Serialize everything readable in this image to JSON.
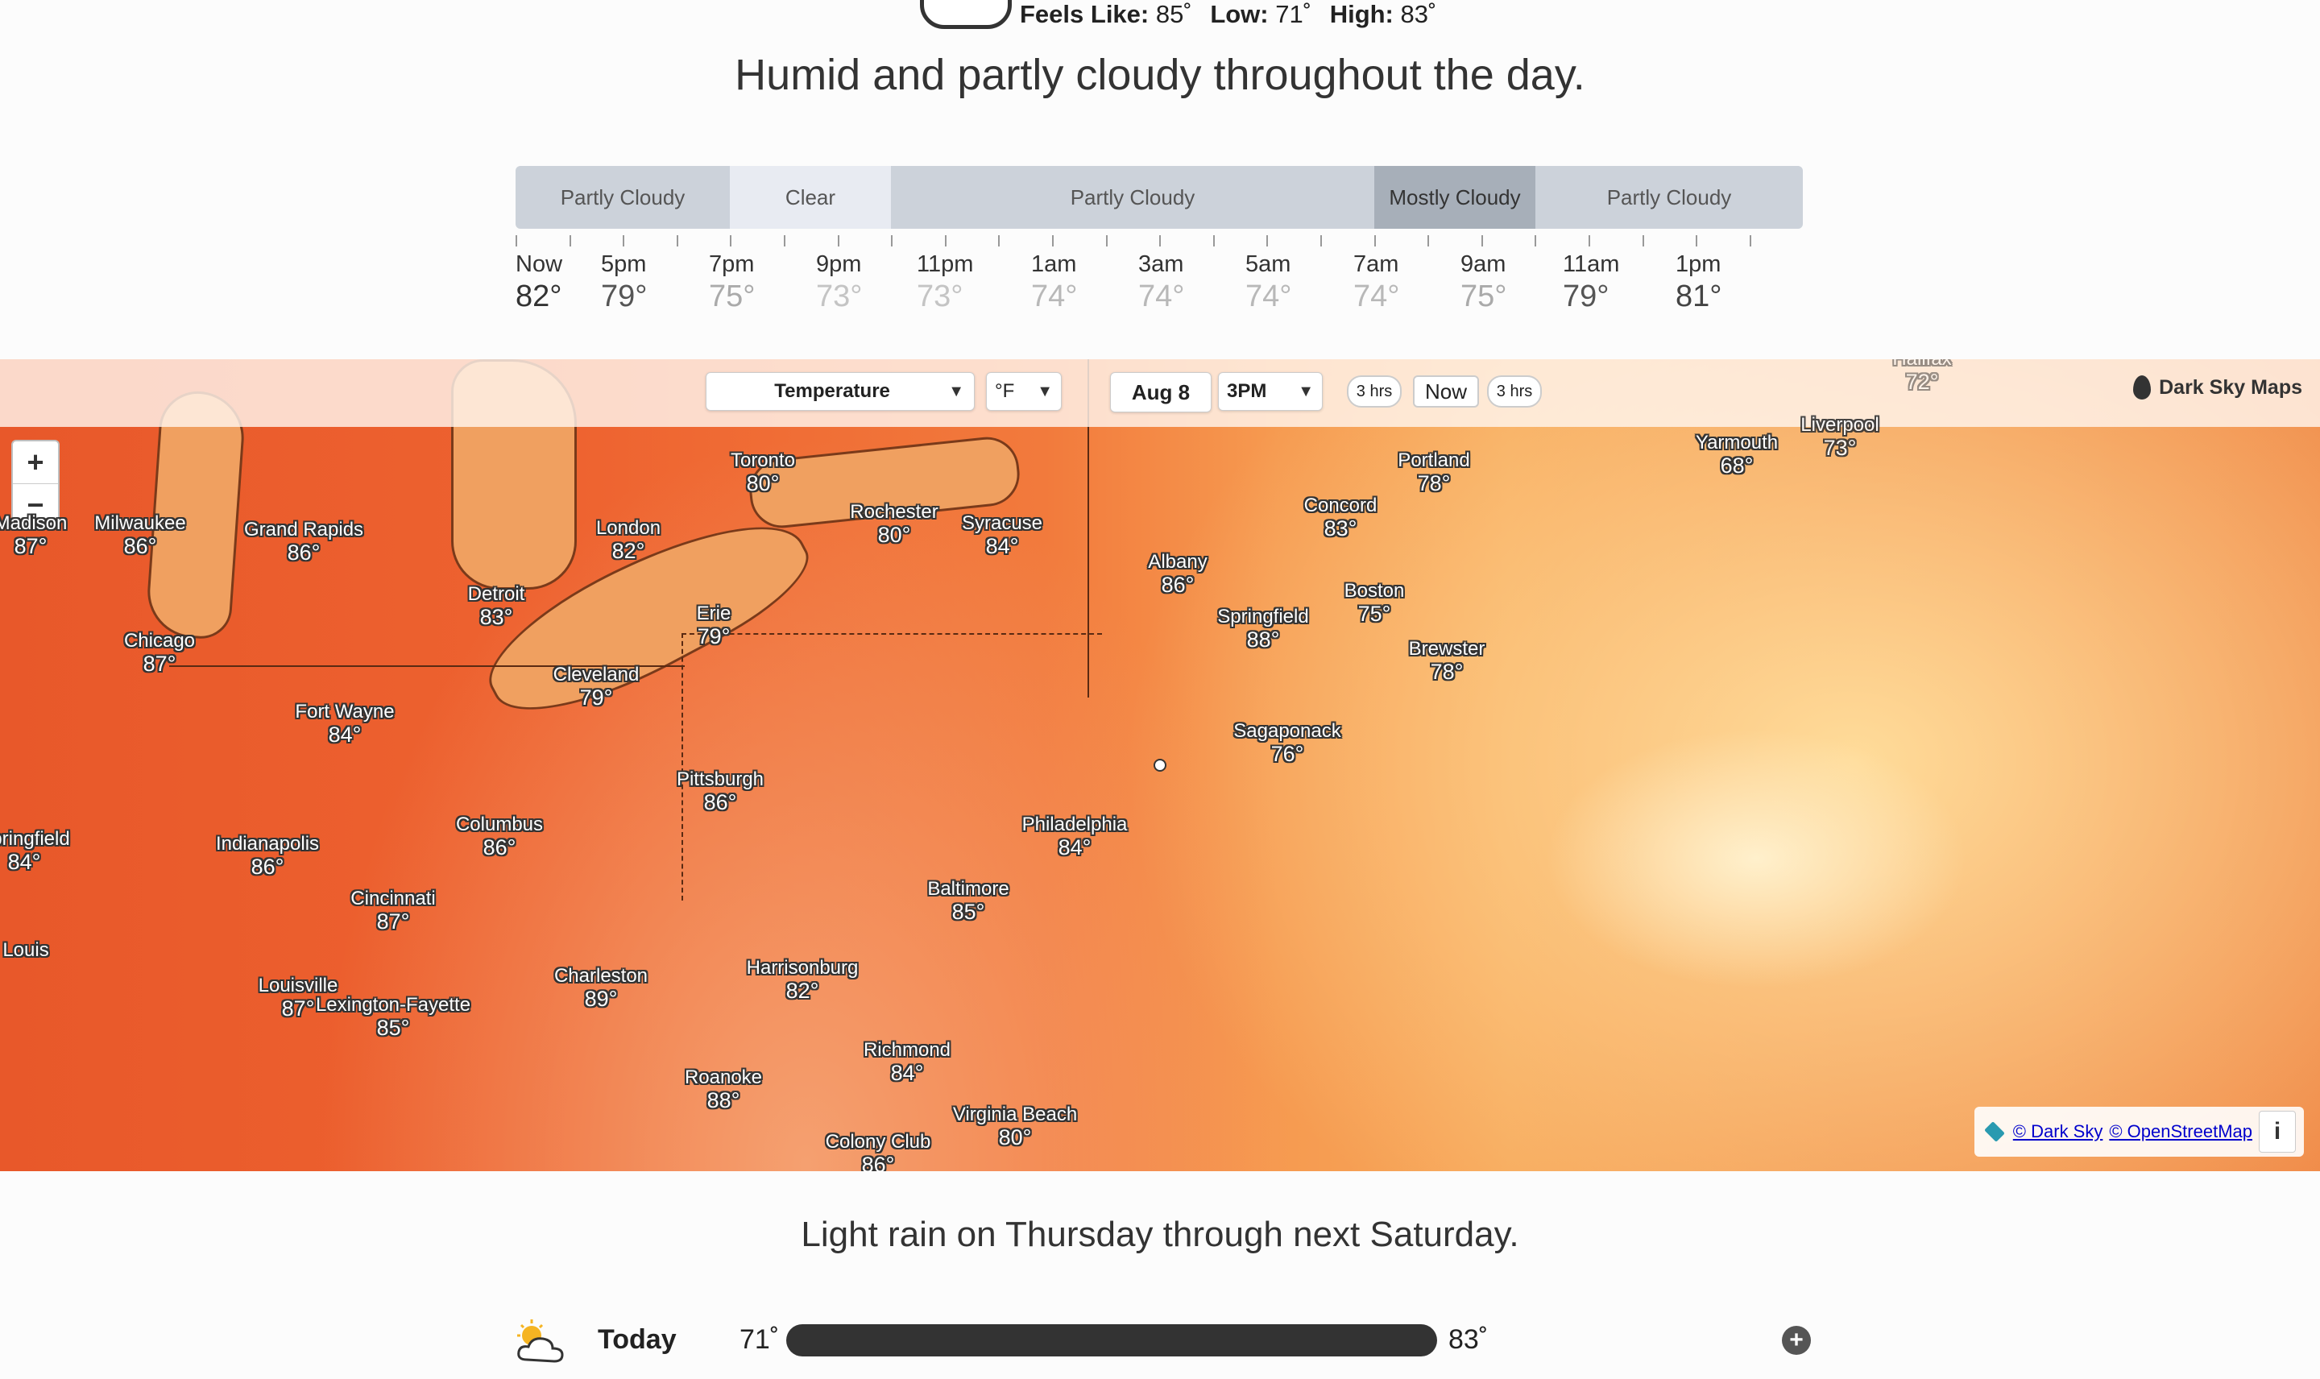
{
  "current": {
    "feels_label": "Feels Like:",
    "feels_value": "85˚",
    "low_label": "Low:",
    "low_value": "71˚",
    "high_label": "High:",
    "high_value": "83˚",
    "summary": "Humid and partly cloudy throughout the day."
  },
  "timeline": {
    "segments": [
      {
        "label": "Partly Cloudy",
        "type": "partly-cloudy"
      },
      {
        "label": "Clear",
        "type": "clear"
      },
      {
        "label": "Partly Cloudy",
        "type": "partly-cloudy"
      },
      {
        "label": "Mostly Cloudy",
        "type": "mostly-cloudy"
      },
      {
        "label": "Partly Cloudy",
        "type": "partly-cloudy"
      }
    ],
    "hours": [
      {
        "label": "Now",
        "temp": "82°"
      },
      {
        "label": "5pm",
        "temp": "79°"
      },
      {
        "label": "7pm",
        "temp": "75°"
      },
      {
        "label": "9pm",
        "temp": "73°"
      },
      {
        "label": "11pm",
        "temp": "73°"
      },
      {
        "label": "1am",
        "temp": "74°"
      },
      {
        "label": "3am",
        "temp": "74°"
      },
      {
        "label": "5am",
        "temp": "74°"
      },
      {
        "label": "7am",
        "temp": "74°"
      },
      {
        "label": "9am",
        "temp": "75°"
      },
      {
        "label": "11am",
        "temp": "79°"
      },
      {
        "label": "1pm",
        "temp": "81°"
      }
    ]
  },
  "map": {
    "layer_select": "Temperature",
    "unit_select": "°F",
    "date": "Aug 8",
    "time_select": "3PM",
    "step_back": "3 hrs",
    "now_label": "Now",
    "step_forward": "3 hrs",
    "brand": "Dark Sky Maps",
    "zoom_in": "+",
    "zoom_out": "−",
    "attribution_darksky": "© Dark Sky",
    "attribution_osm": "© OpenStreetMap",
    "info": "i",
    "cities": [
      {
        "name": "Toronto",
        "temp": "80°"
      },
      {
        "name": "Rochester",
        "temp": "80°"
      },
      {
        "name": "Syracuse",
        "temp": "84°"
      },
      {
        "name": "Portland",
        "temp": "78°"
      },
      {
        "name": "Concord",
        "temp": "83°"
      },
      {
        "name": "Yarmouth",
        "temp": "68°"
      },
      {
        "name": "Liverpool",
        "temp": "73°"
      },
      {
        "name": "Halifax",
        "temp": "72°"
      },
      {
        "name": "Madison",
        "temp": "87°"
      },
      {
        "name": "Milwaukee",
        "temp": "86°"
      },
      {
        "name": "Grand Rapids",
        "temp": "86°"
      },
      {
        "name": "London",
        "temp": "82°"
      },
      {
        "name": "Albany",
        "temp": "86°"
      },
      {
        "name": "Detroit",
        "temp": "83°"
      },
      {
        "name": "Boston",
        "temp": "75°"
      },
      {
        "name": "Springfield",
        "temp": "88°"
      },
      {
        "name": "Erie",
        "temp": "79°"
      },
      {
        "name": "Chicago",
        "temp": "87°"
      },
      {
        "name": "Brewster",
        "temp": "78°"
      },
      {
        "name": "Cleveland",
        "temp": "79°"
      },
      {
        "name": "Fort Wayne",
        "temp": "84°"
      },
      {
        "name": "Sagaponack",
        "temp": "76°"
      },
      {
        "name": "Pittsburgh",
        "temp": "86°"
      },
      {
        "name": "Columbus",
        "temp": "86°"
      },
      {
        "name": "Philadelphia",
        "temp": "84°"
      },
      {
        "name": "Springfield",
        "temp": "84°"
      },
      {
        "name": "Indianapolis",
        "temp": "86°"
      },
      {
        "name": "Baltimore",
        "temp": "85°"
      },
      {
        "name": "Cincinnati",
        "temp": "87°"
      },
      {
        "name": "Harrisonburg",
        "temp": "82°"
      },
      {
        "name": "Charleston",
        "temp": "89°"
      },
      {
        "name": "Louisville",
        "temp": "87°"
      },
      {
        "name": "Lexington-Fayette",
        "temp": "85°"
      },
      {
        "name": "Richmond",
        "temp": "84°"
      },
      {
        "name": "Roanoke",
        "temp": "88°"
      },
      {
        "name": "Virginia Beach",
        "temp": "80°"
      },
      {
        "name": "Colony Club",
        "temp": "86°"
      },
      {
        "name": "St. Louis",
        "temp": ""
      }
    ]
  },
  "weekly": {
    "summary": "Light rain on Thursday through next Saturday.",
    "today_label": "Today",
    "today_low": "71˚",
    "today_high": "83˚",
    "icon": "partly-cloudy-day-icon"
  }
}
